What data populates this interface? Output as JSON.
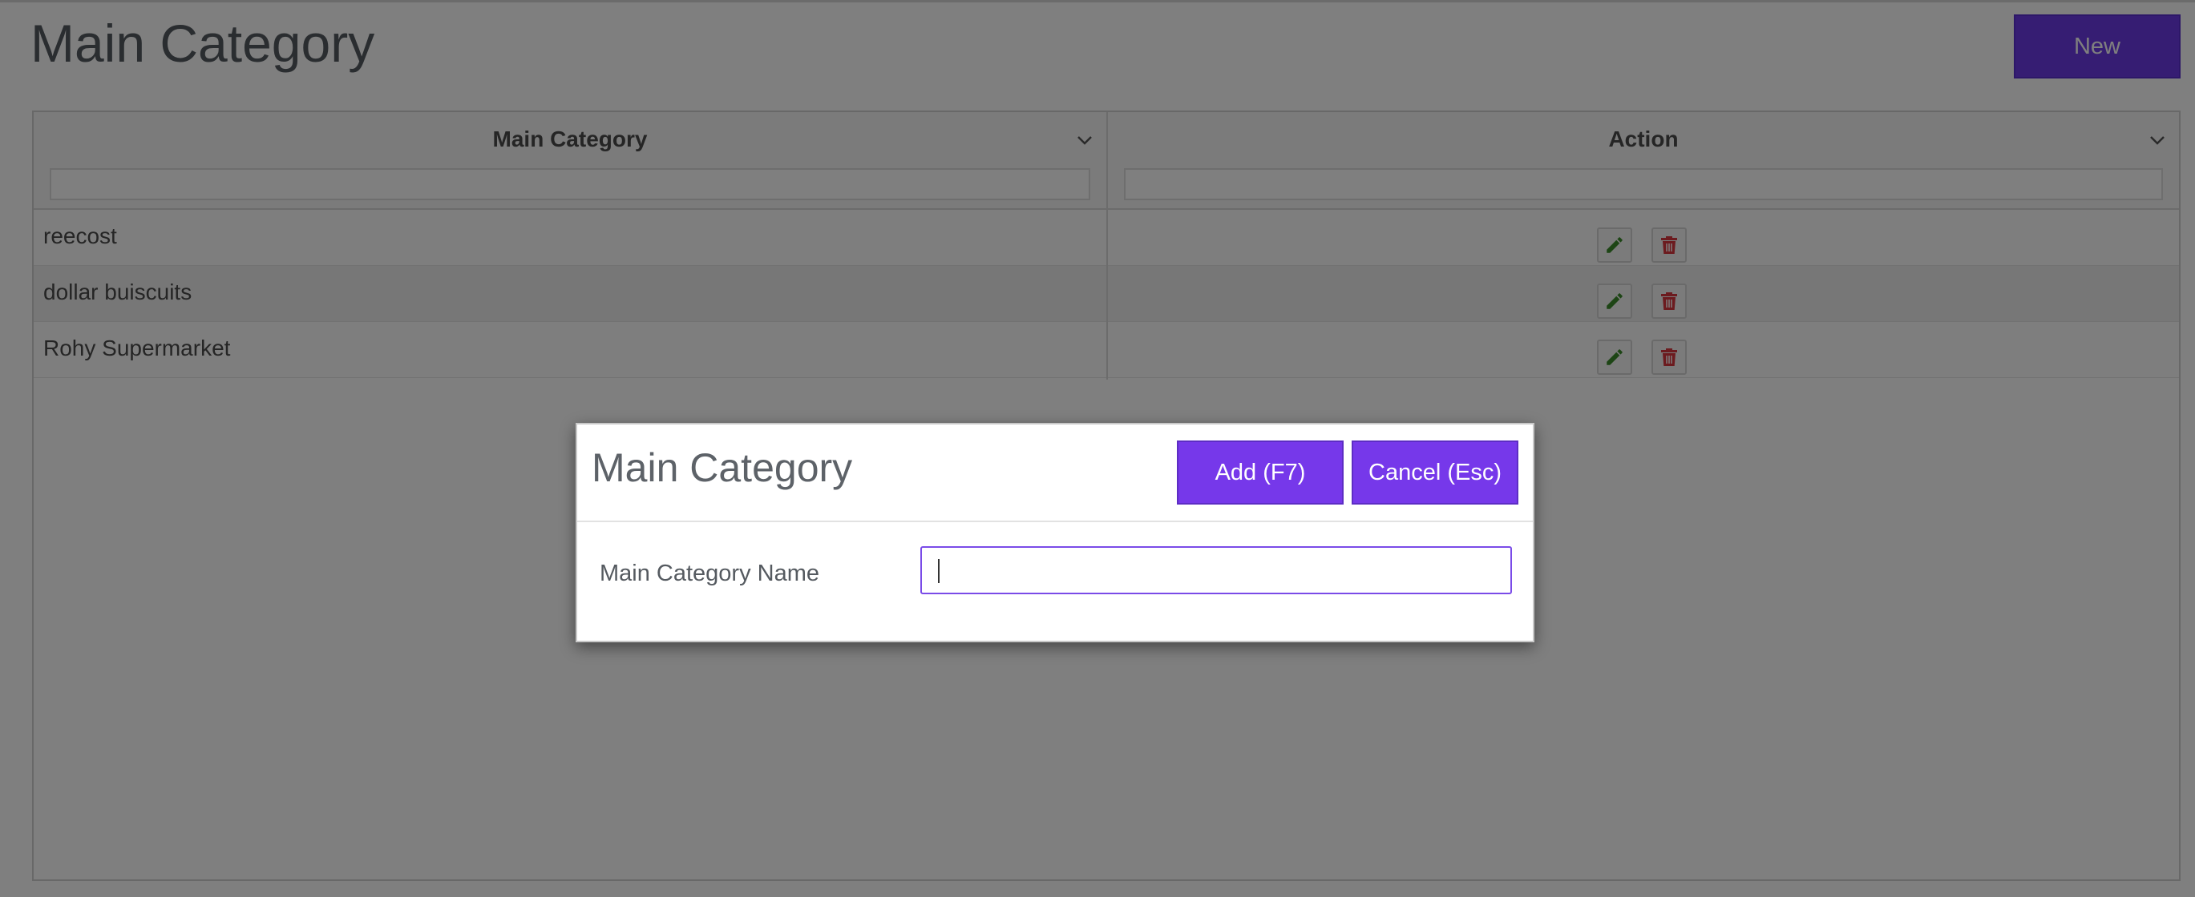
{
  "page": {
    "title": "Main Category",
    "new_label": "New"
  },
  "grid": {
    "columns": [
      {
        "label": "Main Category"
      },
      {
        "label": "Action"
      }
    ],
    "rows": [
      {
        "name": "reecost"
      },
      {
        "name": "dollar buiscuits"
      },
      {
        "name": "Rohy Supermarket"
      }
    ]
  },
  "modal": {
    "title": "Main Category",
    "add_label": "Add (F7)",
    "cancel_label": "Cancel (Esc)",
    "field_label": "Main Category Name",
    "field_value": ""
  },
  "colors": {
    "accent": "#7638ea",
    "edit_icon": "#3a8a2a",
    "delete_icon": "#d9363e"
  },
  "icons": {
    "column_menu": "chevron-down-icon",
    "edit": "pencil-icon",
    "delete": "trash-icon"
  }
}
